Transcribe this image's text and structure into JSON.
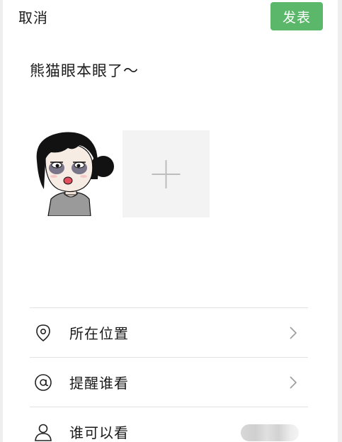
{
  "header": {
    "cancel_label": "取消",
    "publish_label": "发表"
  },
  "post": {
    "text": "熊猫眼本眼了～"
  },
  "media": {
    "add_icon": "plus-icon"
  },
  "options": [
    {
      "label": "所在位置",
      "icon": "location-pin-icon",
      "trailing": "chevron-right-icon"
    },
    {
      "label": "提醒谁看",
      "icon": "at-sign-icon",
      "trailing": "chevron-right-icon"
    },
    {
      "label": "谁可以看",
      "icon": "person-icon",
      "trailing": "blurred-value"
    }
  ],
  "colors": {
    "publish_button": "#5bb76a",
    "background": "#ffffff",
    "divider": "#e2e2e2"
  }
}
